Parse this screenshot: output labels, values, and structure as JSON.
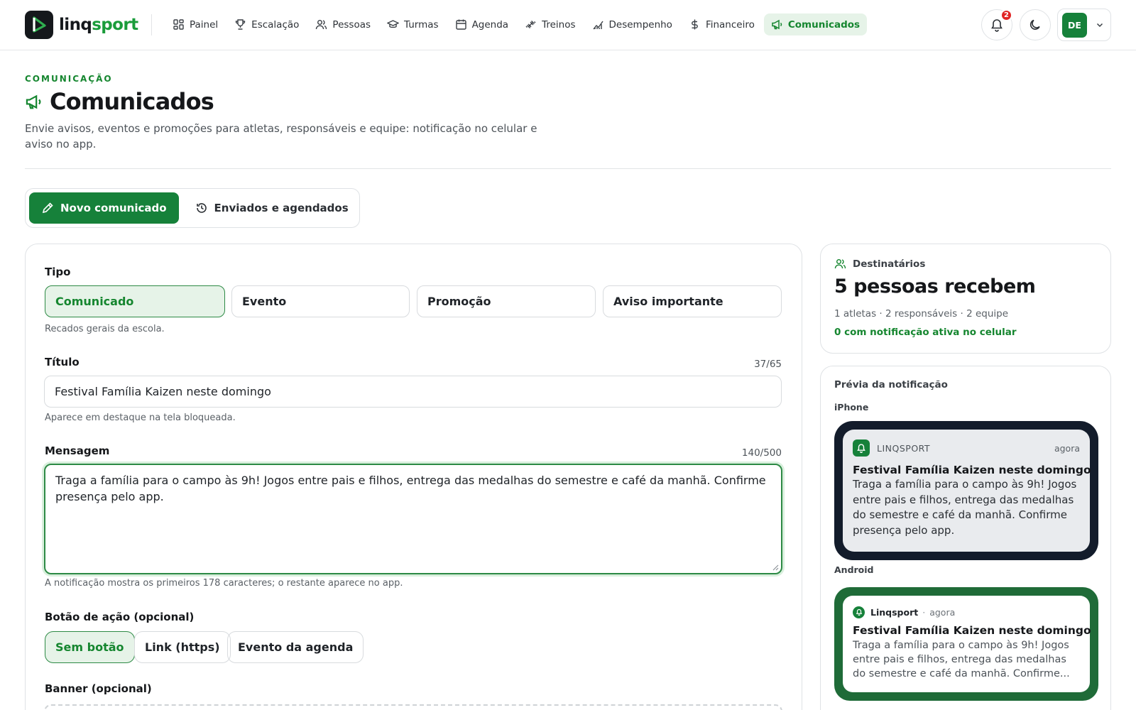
{
  "brand": {
    "name_a": "linq",
    "name_b": "sport"
  },
  "nav": [
    {
      "label": "Painel",
      "icon": "dashboard-icon"
    },
    {
      "label": "Escalação",
      "icon": "trophy-icon"
    },
    {
      "label": "Pessoas",
      "icon": "users-icon"
    },
    {
      "label": "Turmas",
      "icon": "graduation-cap-icon"
    },
    {
      "label": "Agenda",
      "icon": "calendar-icon"
    },
    {
      "label": "Treinos",
      "icon": "dumbbell-icon"
    },
    {
      "label": "Desempenho",
      "icon": "chart-icon"
    },
    {
      "label": "Financeiro",
      "icon": "dollar-icon"
    },
    {
      "label": "Comunicados",
      "icon": "megaphone-icon",
      "active": true
    }
  ],
  "header": {
    "notifications_count": "2",
    "user_initials": "DE",
    "eyebrow": "COMUNICAÇÃO",
    "title": "Comunicados",
    "description": "Envie avisos, eventos e promoções para atletas, responsáveis e equipe: notificação no celular e aviso no app."
  },
  "tabs": {
    "new": "Novo comunicado",
    "sent": "Enviados e agendados"
  },
  "form": {
    "type_label": "Tipo",
    "types": [
      "Comunicado",
      "Evento",
      "Promoção",
      "Aviso importante"
    ],
    "type_selected": "Comunicado",
    "type_hint": "Recados gerais da escola.",
    "title_label": "Título",
    "title_counter": "37/65",
    "title_value": "Festival Família Kaizen neste domingo",
    "title_hint": "Aparece em destaque na tela bloqueada.",
    "message_label": "Mensagem",
    "message_counter": "140/500",
    "message_value": "Traga a família para o campo às 9h! Jogos entre pais e filhos, entrega das medalhas do semestre e café da manhã. Confirme presença pelo app.",
    "message_hint": "A notificação mostra os primeiros 178 caracteres; o restante aparece no app.",
    "action_label": "Botão de ação (opcional)",
    "actions": [
      "Sem botão",
      "Link (https)",
      "Evento da agenda"
    ],
    "action_selected": "Sem botão",
    "banner_label": "Banner (opcional)"
  },
  "recipients": {
    "heading": "Destinatários",
    "count_text": "5 pessoas recebem",
    "breakdown": "1 atletas · 2 responsáveis · 2 equipe",
    "active_text": "0 com notificação ativa no celular"
  },
  "preview": {
    "heading": "Prévia da notificação",
    "iphone_label": "iPhone",
    "ios_app": "LINQSPORT",
    "ios_time": "agora",
    "ios_title": "Festival Família Kaizen neste domingo",
    "ios_body": "Traga a família para o campo às 9h! Jogos entre pais e filhos, entrega das medalhas do semestre e café da manhã. Confirme presença pelo app.",
    "android_label": "Android",
    "and_app": "Linqsport",
    "and_dot": "·",
    "and_time": "agora",
    "and_title": "Festival Família Kaizen neste domingo",
    "and_body": "Traga a família para o campo às 9h! Jogos entre pais e filhos, entrega das medalhas do semestre e café da manhã. Confirme..."
  },
  "colors": {
    "accent": "#16813a",
    "accent_soft": "#e6f3e8",
    "brand_green": "#1a9c3a",
    "badge_red": "#e02424",
    "iphone_frame": "#131c2b",
    "android_frame": "#1f6b38"
  }
}
